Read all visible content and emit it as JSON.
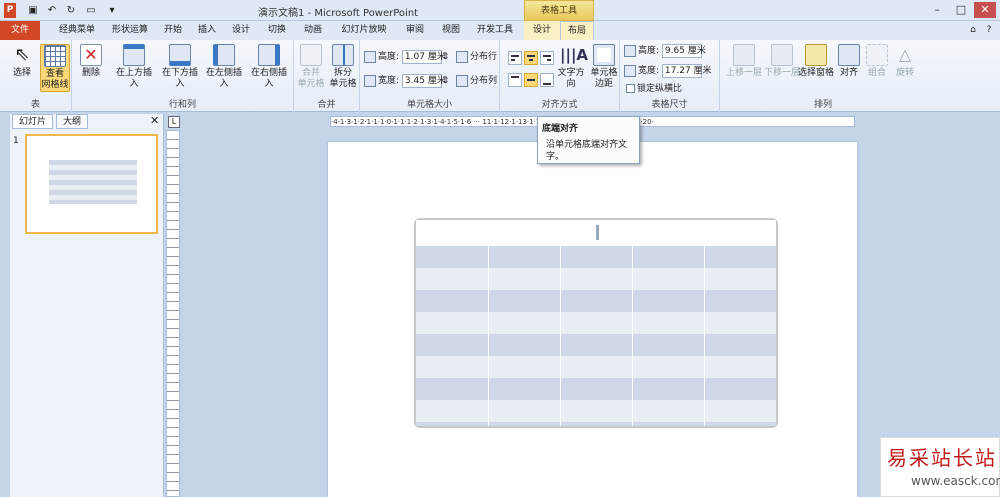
{
  "window": {
    "title": "演示文稿1 - Microsoft PowerPoint",
    "context_group": "表格工具"
  },
  "tabs": [
    {
      "label": "文件"
    },
    {
      "label": "经典菜单"
    },
    {
      "label": "形状运算"
    },
    {
      "label": "开始"
    },
    {
      "label": "插入"
    },
    {
      "label": "设计"
    },
    {
      "label": "切换"
    },
    {
      "label": "动画"
    },
    {
      "label": "幻灯片放映"
    },
    {
      "label": "审阅"
    },
    {
      "label": "视图"
    },
    {
      "label": "开发工具"
    },
    {
      "label": "设计"
    },
    {
      "label": "布局"
    }
  ],
  "ribbon": {
    "table": {
      "label": "表",
      "select": "选择",
      "gridlines_1": "查看",
      "gridlines_2": "网格线"
    },
    "rows_cols": {
      "label": "行和列",
      "delete": "删除",
      "insert_above": "在上方插入",
      "insert_below": "在下方插入",
      "insert_left": "在左侧插入",
      "insert_right": "在右侧插入"
    },
    "merge": {
      "label": "合并",
      "merge_1": "合并",
      "merge_2": "单元格",
      "split_1": "拆分",
      "split_2": "单元格"
    },
    "cell_size": {
      "label": "单元格大小",
      "height_label": "高度:",
      "height_value": "1.07 厘米",
      "width_label": "宽度:",
      "width_value": "3.45 厘米",
      "dist_rows": "分布行",
      "dist_cols": "分布列"
    },
    "alignment": {
      "label": "对齐方式",
      "text_dir": "文字方向",
      "margins_1": "单元格",
      "margins_2": "边距"
    },
    "table_size": {
      "label": "表格尺寸",
      "height_label": "高度:",
      "height_value": "9.65 厘米",
      "width_label": "宽度:",
      "width_value": "17.27 厘米",
      "lock_ratio": "锁定纵横比"
    },
    "arrange": {
      "label": "排列",
      "bring_forward": "上移一层",
      "send_backward": "下移一层",
      "selection_pane": "选择窗格",
      "align": "对齐",
      "group": "组合",
      "rotate": "旋转"
    }
  },
  "panel": {
    "tab_slides": "幻灯片",
    "tab_outline": "大纲",
    "slide_number": "1"
  },
  "ruler": {
    "h": "·4·1·3·1·2·1·1·1·0·1·1·1·2·1·3·1·4·1·5·1·6 ··· 11·1·12·1·13·1·14·1·15·1·16·1·17·1·18·1·19·1·20·"
  },
  "tooltip": {
    "title": "底端对齐",
    "desc": "沿单元格底端对齐文字。"
  },
  "watermark": {
    "brand": "易采站长站",
    "url": "www.easck.com"
  },
  "colors": {
    "file_tab": "#d24726",
    "band": "#d0d8e8",
    "band_light": "#e9edf4",
    "selected": "#fbd97a"
  }
}
